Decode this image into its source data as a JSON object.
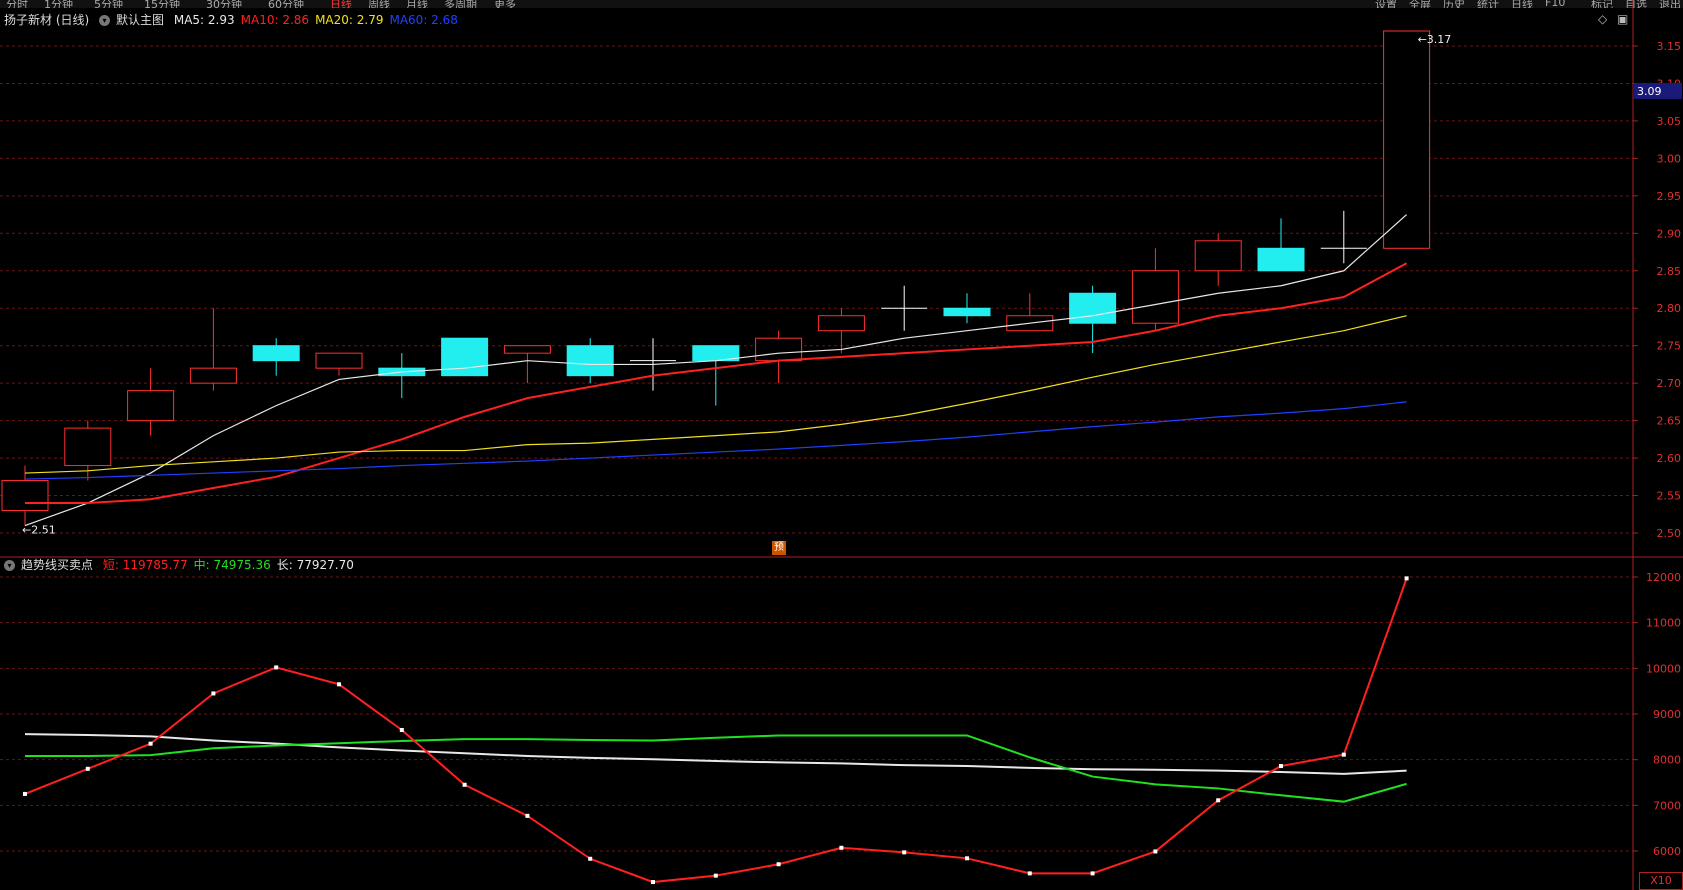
{
  "window": {
    "period_tabs": [
      "分时",
      "1分钟",
      "5分钟",
      "15分钟",
      "30分钟",
      "60分钟",
      "日线",
      "周线",
      "月线",
      "多周期",
      "更多"
    ],
    "active_period": "日线",
    "right_tools": [
      "设置",
      "全屏",
      "历史",
      "统计",
      "日线",
      "F10",
      "标记",
      "自选",
      "退出"
    ]
  },
  "main_panel": {
    "stock_label": "扬子新材 (日线)",
    "view_name": "默认主图",
    "ma": [
      {
        "label": "MA5: 2.93",
        "color": "#e8e8e8"
      },
      {
        "label": "MA10: 2.86",
        "color": "#ff2020"
      },
      {
        "label": "MA20: 2.79",
        "color": "#f0e020"
      },
      {
        "label": "MA60: 2.68",
        "color": "#2040ff"
      }
    ],
    "current_price_label": "3.09",
    "high_annot": "3.17",
    "low_annot": "2.51",
    "pre_badge": "预",
    "icons": {
      "diamond": "◇",
      "panel": "▣"
    }
  },
  "sub_panel": {
    "indicator_name": "趋势线买卖点",
    "values": [
      {
        "label": "短: 119785.77",
        "color": "#ff2020"
      },
      {
        "label": "中: 74975.36",
        "color": "#20e020"
      },
      {
        "label": "长: 77927.70",
        "color": "#e8e8e8"
      }
    ],
    "scale_badge": "X10"
  },
  "chart_data": [
    {
      "type": "candlestick",
      "title": "扬子新材 (日线)",
      "ylim": [
        2.48,
        3.18
      ],
      "yticks": [
        "3.15",
        "3.10",
        "3.05",
        "3.00",
        "2.95",
        "2.90",
        "2.85",
        "2.80",
        "2.75",
        "2.70",
        "2.65",
        "2.60",
        "2.55",
        "2.50"
      ],
      "candles": [
        {
          "o": 2.53,
          "h": 2.59,
          "l": 2.51,
          "c": 2.57
        },
        {
          "o": 2.59,
          "h": 2.65,
          "l": 2.57,
          "c": 2.64
        },
        {
          "o": 2.65,
          "h": 2.72,
          "l": 2.63,
          "c": 2.69
        },
        {
          "o": 2.7,
          "h": 2.8,
          "l": 2.69,
          "c": 2.72
        },
        {
          "o": 2.75,
          "h": 2.76,
          "l": 2.71,
          "c": 2.73
        },
        {
          "o": 2.72,
          "h": 2.74,
          "l": 2.71,
          "c": 2.74
        },
        {
          "o": 2.72,
          "h": 2.74,
          "l": 2.68,
          "c": 2.71
        },
        {
          "o": 2.76,
          "h": 2.76,
          "l": 2.71,
          "c": 2.71
        },
        {
          "o": 2.74,
          "h": 2.75,
          "l": 2.7,
          "c": 2.75
        },
        {
          "o": 2.75,
          "h": 2.76,
          "l": 2.7,
          "c": 2.71
        },
        {
          "o": 2.73,
          "h": 2.76,
          "l": 2.69,
          "c": 2.73
        },
        {
          "o": 2.75,
          "h": 2.75,
          "l": 2.67,
          "c": 2.73
        },
        {
          "o": 2.73,
          "h": 2.77,
          "l": 2.7,
          "c": 2.76
        },
        {
          "o": 2.77,
          "h": 2.8,
          "l": 2.74,
          "c": 2.79
        },
        {
          "o": 2.8,
          "h": 2.83,
          "l": 2.77,
          "c": 2.8
        },
        {
          "o": 2.8,
          "h": 2.82,
          "l": 2.78,
          "c": 2.79
        },
        {
          "o": 2.77,
          "h": 2.82,
          "l": 2.77,
          "c": 2.79
        },
        {
          "o": 2.82,
          "h": 2.83,
          "l": 2.74,
          "c": 2.78
        },
        {
          "o": 2.78,
          "h": 2.88,
          "l": 2.77,
          "c": 2.85
        },
        {
          "o": 2.85,
          "h": 2.9,
          "l": 2.83,
          "c": 2.89
        },
        {
          "o": 2.88,
          "h": 2.92,
          "l": 2.85,
          "c": 2.85
        },
        {
          "o": 2.88,
          "h": 2.93,
          "l": 2.86,
          "c": 2.88
        },
        {
          "o": 2.88,
          "h": 3.17,
          "l": 2.88,
          "c": 3.17
        }
      ],
      "series": [
        {
          "name": "MA5",
          "color": "#e8e8e8",
          "values": [
            2.51,
            2.54,
            2.58,
            2.63,
            2.67,
            2.705,
            2.715,
            2.72,
            2.73,
            2.725,
            2.725,
            2.73,
            2.74,
            2.745,
            2.76,
            2.77,
            2.78,
            2.79,
            2.805,
            2.82,
            2.83,
            2.85,
            2.925
          ]
        },
        {
          "name": "MA10",
          "color": "#ff2020",
          "values": [
            2.54,
            2.54,
            2.545,
            2.56,
            2.575,
            2.6,
            2.625,
            2.655,
            2.68,
            2.695,
            2.71,
            2.72,
            2.73,
            2.735,
            2.74,
            2.745,
            2.75,
            2.755,
            2.77,
            2.79,
            2.8,
            2.815,
            2.86
          ]
        },
        {
          "name": "MA20",
          "color": "#f0e020",
          "values": [
            2.58,
            2.583,
            2.59,
            2.595,
            2.6,
            2.608,
            2.61,
            2.61,
            2.618,
            2.62,
            2.625,
            2.63,
            2.635,
            2.645,
            2.657,
            2.673,
            2.69,
            2.708,
            2.725,
            2.74,
            2.755,
            2.77,
            2.79
          ]
        },
        {
          "name": "MA60",
          "color": "#2040ff",
          "values": [
            2.572,
            2.574,
            2.577,
            2.58,
            2.583,
            2.586,
            2.59,
            2.593,
            2.596,
            2.6,
            2.604,
            2.608,
            2.612,
            2.617,
            2.622,
            2.628,
            2.635,
            2.642,
            2.648,
            2.655,
            2.66,
            2.666,
            2.675
          ]
        }
      ]
    },
    {
      "type": "line",
      "title": "趋势线买卖点",
      "ylim": [
        5400,
        12400
      ],
      "yticks": [
        "12000",
        "11000",
        "10000",
        "9000",
        "8000",
        "7000",
        "6000"
      ],
      "series": [
        {
          "name": "短",
          "color": "#ff2020",
          "values": [
            7250,
            7800,
            8350,
            9450,
            10020,
            9650,
            8650,
            7450,
            6770,
            5830,
            5320,
            5460,
            5710,
            6070,
            5970,
            5840,
            5510,
            5510,
            5990,
            7110,
            7860,
            8110,
            11970
          ]
        },
        {
          "name": "中",
          "color": "#20e020",
          "values": [
            8080,
            8080,
            8100,
            8250,
            8310,
            8360,
            8410,
            8450,
            8450,
            8430,
            8420,
            8480,
            8530,
            8530,
            8530,
            8530,
            8050,
            7630,
            7460,
            7370,
            7220,
            7080,
            7470
          ]
        },
        {
          "name": "长",
          "color": "#e8e8e8",
          "values": [
            8560,
            8540,
            8510,
            8420,
            8350,
            8270,
            8200,
            8140,
            8080,
            8040,
            8010,
            7970,
            7940,
            7920,
            7880,
            7860,
            7820,
            7790,
            7780,
            7760,
            7730,
            7690,
            7760
          ]
        }
      ]
    }
  ]
}
